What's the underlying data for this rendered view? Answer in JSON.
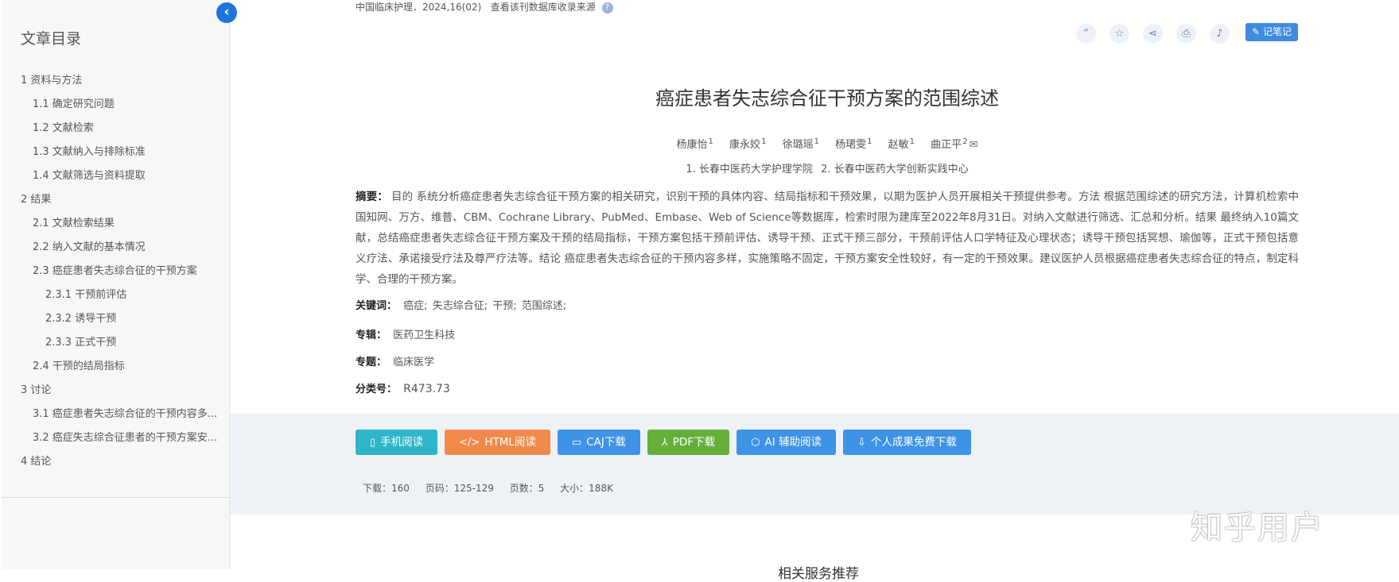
{
  "source": {
    "journal": "中国临床护理．2024,16(02)",
    "db_link": "查看该刊数据库收录来源",
    "help_icon": "?"
  },
  "sidebar": {
    "title": "文章目录",
    "collapse_icon": "‹",
    "items": [
      {
        "label": "1 资料与方法",
        "level": 1
      },
      {
        "label": "1.1 确定研究问题",
        "level": 2
      },
      {
        "label": "1.2 文献检索",
        "level": 2
      },
      {
        "label": "1.3 文献纳入与排除标准",
        "level": 2
      },
      {
        "label": "1.4 文献筛选与资料提取",
        "level": 2
      },
      {
        "label": "2 结果",
        "level": 1
      },
      {
        "label": "2.1 文献检索结果",
        "level": 2
      },
      {
        "label": "2.2 纳入文献的基本情况",
        "level": 2
      },
      {
        "label": "2.3 癌症患者失志综合征的干预方案",
        "level": 2
      },
      {
        "label": "2.3.1 干预前评估",
        "level": 3
      },
      {
        "label": "2.3.2 诱导干预",
        "level": 3
      },
      {
        "label": "2.3.3 正式干预",
        "level": 3
      },
      {
        "label": "2.4 干预的结局指标",
        "level": 2
      },
      {
        "label": "3 讨论",
        "level": 1
      },
      {
        "label": "3.1 癌症患者失志综合征的干预内容多...",
        "level": 2
      },
      {
        "label": "3.2 癌症失志综合征患者的干预方案安...",
        "level": 2
      },
      {
        "label": "4 结论",
        "level": 1
      }
    ]
  },
  "toolbar": {
    "icons": [
      "quote-icon",
      "star-icon",
      "share-icon",
      "print-icon",
      "bell-icon"
    ],
    "icon_glyphs": [
      "“",
      "☆",
      "⋖",
      "⎙",
      "♪"
    ],
    "note_label": "记笔记",
    "note_icon": "✎"
  },
  "article": {
    "title": "癌症患者失志综合征干预方案的范围综述",
    "authors": [
      {
        "name": "杨康怡",
        "sup": "1"
      },
      {
        "name": "康永姣",
        "sup": "1"
      },
      {
        "name": "徐璐瑶",
        "sup": "1"
      },
      {
        "name": "杨珺雯",
        "sup": "1"
      },
      {
        "name": "赵敏",
        "sup": "1"
      },
      {
        "name": "曲正平",
        "sup": "2"
      }
    ],
    "mail_icon": "✉",
    "affiliations": [
      "1. 长春中医药大学护理学院",
      "2. 长春中医药大学创新实践中心"
    ],
    "abstract_label": "摘要：",
    "abstract_text": "目的 系统分析癌症患者失志综合征干预方案的相关研究，识别干预的具体内容、结局指标和干预效果，以期为医护人员开展相关干预提供参考。方法 根据范围综述的研究方法，计算机检索中国知网、万方、维普、CBM、Cochrane Library、PubMed、Embase、Web of Science等数据库，检索时限为建库至2022年8月31日。对纳入文献进行筛选、汇总和分析。结果 最终纳入10篇文献，总结癌症患者失志综合征干预方案及干预的结局指标，干预方案包括干预前评估、诱导干预、正式干预三部分，干预前评估人口学特征及心理状态；诱导干预包括冥想、瑜伽等，正式干预包括意义疗法、承诺接受疗法及尊严疗法等。结论 癌症患者失志综合征的干预内容多样，实施策略不固定，干预方案安全性较好，有一定的干预效果。建议医护人员根据癌症患者失志综合征的特点，制定科学、合理的干预方案。",
    "keywords_label": "关键词：",
    "keywords": [
      "癌症;",
      "失志综合征;",
      "干预;",
      "范围综述;"
    ],
    "series_label": "专辑：",
    "series": "医药卫生科技",
    "topic_label": "专题：",
    "topic": "临床医学",
    "class_label": "分类号：",
    "class_no": "R473.73"
  },
  "downloads": {
    "buttons": [
      {
        "icon": "▯",
        "label": "手机阅读"
      },
      {
        "icon": "</>",
        "label": "HTML阅读"
      },
      {
        "icon": "▭",
        "label": "CAJ下载"
      },
      {
        "icon": "⅄",
        "label": "PDF下载"
      },
      {
        "icon": "⬡",
        "label": "AI 辅助阅读"
      },
      {
        "icon": "⇩",
        "label": "个人成果免费下载"
      }
    ],
    "stats": [
      "下载：160",
      "页码：125-129",
      "页数：5",
      "大小：188K"
    ]
  },
  "related_title": "相关服务推荐",
  "watermark": "知乎用户",
  "colors": {
    "accent": "#1f74d8",
    "mobile": "#2fb5c9",
    "html": "#f08a4b",
    "caj": "#3d93e6",
    "pdf": "#66b03a"
  }
}
